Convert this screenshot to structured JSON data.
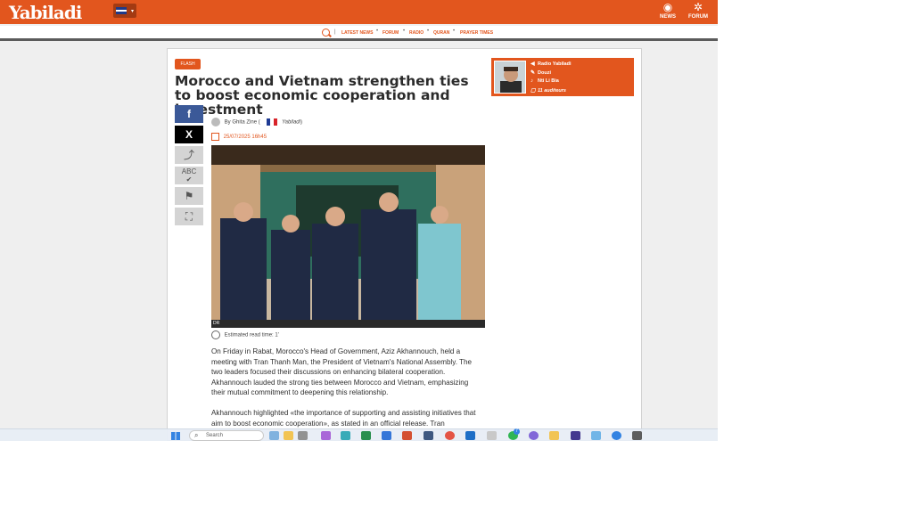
{
  "header": {
    "logo": "Yabiladi",
    "lang_caret": "▾",
    "news_icon": "globe-icon",
    "news_label": "NEWS",
    "forum_icon": "forum-icon",
    "forum_label": "FORUM",
    "brand_color": "#e2561e"
  },
  "nav": {
    "sep": "|",
    "items": [
      "LATEST NEWS",
      "FORUM",
      "RADIO",
      "QURAN",
      "PRAYER TIMES"
    ],
    "dot": "•"
  },
  "article": {
    "category": "FLASH",
    "title": "Morocco and Vietnam strengthen ties to boost economic cooperation and investment",
    "author_prefix": "By",
    "author_name": "Ghita Zine",
    "author_open": "(",
    "author_source": "Yabiladi",
    "author_close": ")",
    "date": "25/07/2025 16h45",
    "photo_credit": "DR",
    "read_time": "Estimated read time: 1'",
    "paragraph_1": "On Friday in Rabat, Morocco's Head of Government, Aziz Akhannouch, held a meeting with Tran Thanh Man, the President of Vietnam's National Assembly. The two leaders focused their discussions on enhancing bilateral cooperation. Akhannouch lauded the strong ties between Morocco and Vietnam, emphasizing their mutual commitment to deepening this relationship.",
    "paragraph_2": "Akhannouch highlighted «the importance of supporting and assisting initiatives that aim to boost economic cooperation», as stated in an official release. Tran"
  },
  "share": {
    "facebook_glyph": "f",
    "x_glyph": "X",
    "share_glyph": "⤴",
    "spell_text": "ABC",
    "spell_check": "✔",
    "report_glyph": "⚑",
    "fullscreen_glyph": "⛶"
  },
  "radio": {
    "station": "Radio Yabiladi",
    "artist": "Douzi",
    "song": "Nti Li Bia",
    "listeners": "11 auditeurs",
    "station_icon": "speaker-icon",
    "artist_icon": "microphone-icon",
    "song_icon": "music-note-icon",
    "listeners_icon": "listeners-icon"
  },
  "taskbar": {
    "search_placeholder": "Search",
    "badge_count": "7"
  }
}
